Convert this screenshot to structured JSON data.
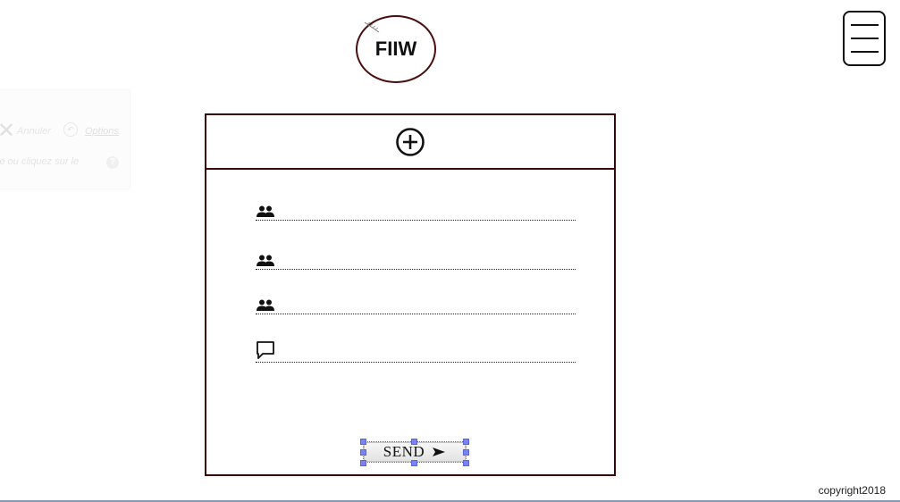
{
  "ghost_overlay": {
    "close_glyph": "✕",
    "text_start": "Annuler",
    "undo_glyph": "↶",
    "options_label": "Options",
    "hint_text": "le ou cliquez sur le",
    "help_glyph": "?"
  },
  "header": {
    "logo_text": "FIIW",
    "logo_border_color": "#4a0e0e",
    "menu_icon": "hamburger-menu-icon"
  },
  "form": {
    "add_icon": "plus-circle-icon",
    "border_color": "#3b0606",
    "fields": [
      {
        "icon": "people-icon",
        "value": "",
        "placeholder": ""
      },
      {
        "icon": "people-icon",
        "value": "",
        "placeholder": ""
      },
      {
        "icon": "people-icon",
        "value": "",
        "placeholder": ""
      },
      {
        "icon": "comment-icon",
        "value": "",
        "placeholder": ""
      }
    ],
    "send_label": "SEND",
    "send_icon": "send-arrow-icon",
    "selection_handle_color": "#7b83f2"
  },
  "footer": {
    "copyright": "copyright2018"
  }
}
